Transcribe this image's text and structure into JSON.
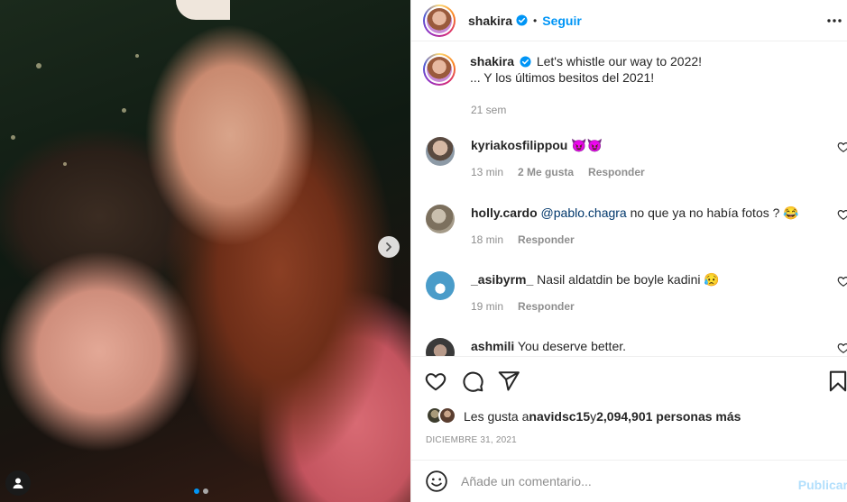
{
  "post": {
    "photo": {
      "carousel_dots": 2,
      "active_dot": 1
    },
    "header": {
      "username": "shakira",
      "separator": "•",
      "follow_label": "Seguir"
    },
    "caption": {
      "username": "shakira",
      "line1": "Let's whistle our way to 2022!",
      "line2": "... Y los últimos besitos del 2021!",
      "time": "21 sem"
    },
    "comments": [
      {
        "username": "kyriakosfilippou",
        "text": " 😈😈",
        "time": "13 min",
        "likes": "2 Me gusta",
        "reply": "Responder"
      },
      {
        "username": "holly.cardo",
        "mention": "@pablo.chagra",
        "text": " no que ya no había fotos ? 😂",
        "time": "18 min",
        "reply": "Responder"
      },
      {
        "username": "_asibyrm_",
        "text": " Nasil aldatdin be boyle kadini 😥",
        "time": "19 min",
        "reply": "Responder"
      },
      {
        "username": "ashmili",
        "text": " You deserve better."
      }
    ],
    "likes": {
      "prefix": "Les gusta a ",
      "user": "navidsc15",
      "middle": " y ",
      "count": "2,094,901 personas más"
    },
    "date": "DICIEMBRE 31, 2021",
    "add_comment": {
      "placeholder": "Añade un comentario...",
      "publish_label": "Publicar"
    }
  },
  "colors": {
    "link": "#0095f6",
    "verified": "#0095f6",
    "publish_disabled": "#b2dffc",
    "muted": "#8e8e8e"
  },
  "icons": [
    "chevron-right-icon",
    "tag-user-icon",
    "verified-badge-icon",
    "more-options-icon",
    "heart-icon",
    "comment-icon",
    "share-icon",
    "save-icon",
    "emoji-icon"
  ]
}
